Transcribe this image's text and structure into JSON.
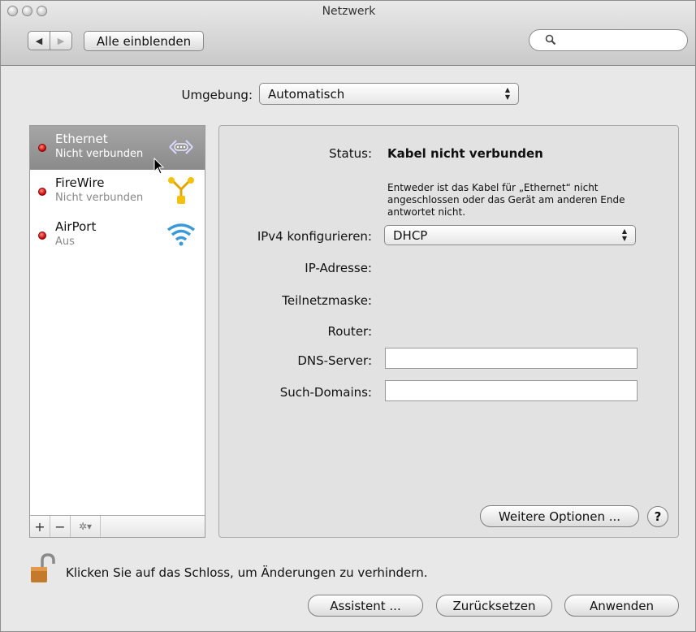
{
  "window": {
    "title": "Netzwerk"
  },
  "toolbar": {
    "back_glyph": "◀",
    "forward_glyph": "▶",
    "show_all_label": "Alle einblenden",
    "search_placeholder": "",
    "search_icon": "search-icon"
  },
  "location": {
    "label": "Umgebung:",
    "value": "Automatisch"
  },
  "services": [
    {
      "name": "Ethernet",
      "status": "Nicht verbunden",
      "icon": "ethernet-icon",
      "selected": true,
      "status_color": "#cc0000"
    },
    {
      "name": "FireWire",
      "status": "Nicht verbunden",
      "icon": "firewire-icon",
      "selected": false,
      "status_color": "#cc0000"
    },
    {
      "name": "AirPort",
      "status": "Aus",
      "icon": "wifi-icon",
      "selected": false,
      "status_color": "#cc0000"
    }
  ],
  "sidebar_toolbar": {
    "add": "+",
    "remove": "−",
    "gear": "✲▾"
  },
  "detail": {
    "status_label": "Status:",
    "status_value": "Kabel nicht verbunden",
    "status_description": "Entweder ist das Kabel für „Ethernet“ nicht angeschlossen oder das Gerät am anderen Ende antwortet nicht.",
    "ipv4_label": "IPv4 konfigurieren:",
    "ipv4_value": "DHCP",
    "ip_label": "IP-Adresse:",
    "subnet_label": "Teilnetzmaske:",
    "router_label": "Router:",
    "dns_label": "DNS-Server:",
    "dns_value": "",
    "search_domains_label": "Such-Domains:",
    "search_domains_value": "",
    "more_options_label": "Weitere Optionen ...",
    "help_label": "?"
  },
  "lock": {
    "text": "Klicken Sie auf das Schloss, um Änderungen zu verhindern."
  },
  "buttons": {
    "assistant": "Assistent ...",
    "revert": "Zurücksetzen",
    "apply": "Anwenden"
  },
  "colors": {
    "selected_row": "#9a9a9a",
    "status_red": "#cc0000",
    "accent_blue": "#3a9ad9"
  }
}
